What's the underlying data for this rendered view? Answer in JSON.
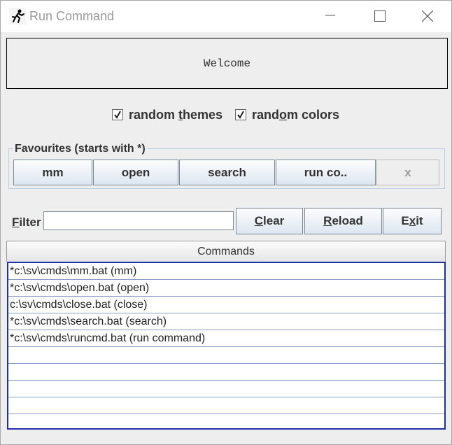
{
  "window": {
    "title": "Run Command",
    "app_icon": "running-man-icon"
  },
  "welcome_text": "Welcome",
  "options": {
    "random_themes": {
      "label_pre": "random ",
      "label_u": "t",
      "label_post": "hemes",
      "checked": true
    },
    "random_colors": {
      "label_pre": "rand",
      "label_u": "o",
      "label_post": "m colors",
      "checked": true
    }
  },
  "favourites": {
    "legend": "Favourites (starts with *)",
    "buttons": [
      "mm",
      "open",
      "search",
      "run co..",
      "x"
    ]
  },
  "filter": {
    "label_u": "F",
    "label_rest": "ilter",
    "value": "",
    "placeholder": ""
  },
  "actions": {
    "clear": {
      "u": "C",
      "rest": "lear"
    },
    "reload": {
      "u": "R",
      "rest": "eload"
    },
    "exit": {
      "pre": "E",
      "u": "x",
      "rest": "it"
    }
  },
  "table": {
    "header": "Commands",
    "rows": [
      "*c:\\sv\\cmds\\mm.bat (mm)",
      "*c:\\sv\\cmds\\open.bat (open)",
      "c:\\sv\\cmds\\close.bat (close)",
      "*c:\\sv\\cmds\\search.bat (search)",
      "*c:\\sv\\cmds\\runcmd.bat (run command)",
      "",
      "",
      "",
      "",
      ""
    ]
  }
}
